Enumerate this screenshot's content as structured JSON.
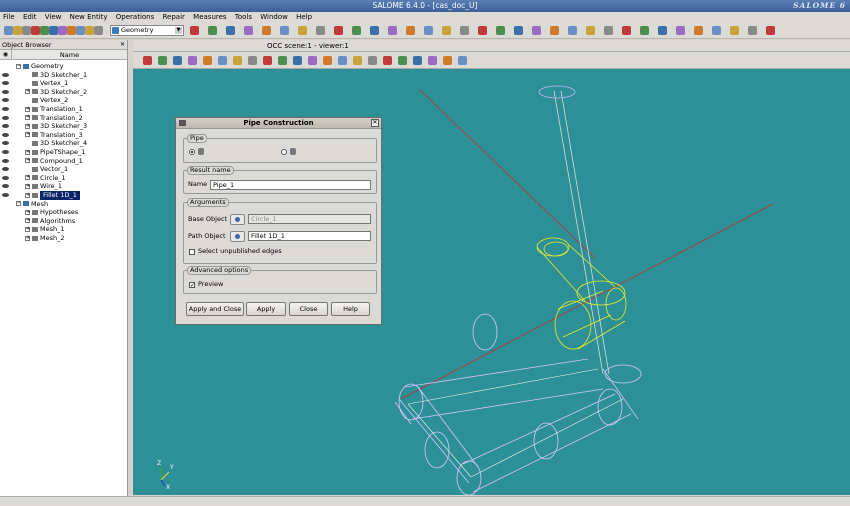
{
  "window": {
    "title": "SALOME 6.4.0 - [cas_doc_U]",
    "brand": "SALOME 6"
  },
  "menu": [
    "File",
    "Edit",
    "View",
    "New Entity",
    "Operations",
    "Repair",
    "Measures",
    "Tools",
    "Window",
    "Help"
  ],
  "toolbar": {
    "module": "Geometry"
  },
  "object_browser": {
    "title": "Object Browser",
    "column_name": "Name",
    "items": [
      {
        "label": "Geometry",
        "depth": 0,
        "expand": "−",
        "eye": false,
        "icon": "geometry-icon"
      },
      {
        "label": "3D Sketcher_1",
        "depth": 1,
        "expand": "",
        "eye": true,
        "icon": "sketch-icon"
      },
      {
        "label": "Vertex_1",
        "depth": 1,
        "expand": "",
        "eye": true,
        "icon": "vertex-icon"
      },
      {
        "label": "3D Sketcher_2",
        "depth": 1,
        "expand": "+",
        "eye": true,
        "icon": "sketch-icon"
      },
      {
        "label": "Vertex_2",
        "depth": 1,
        "expand": "",
        "eye": true,
        "icon": "vertex-icon"
      },
      {
        "label": "Translation_1",
        "depth": 1,
        "expand": "+",
        "eye": true,
        "icon": "translation-icon"
      },
      {
        "label": "Translation_2",
        "depth": 1,
        "expand": "+",
        "eye": true,
        "icon": "translation-icon"
      },
      {
        "label": "3D Sketcher_3",
        "depth": 1,
        "expand": "+",
        "eye": true,
        "icon": "sketch-icon"
      },
      {
        "label": "Translation_3",
        "depth": 1,
        "expand": "+",
        "eye": true,
        "icon": "translation-icon"
      },
      {
        "label": "3D Sketcher_4",
        "depth": 1,
        "expand": "",
        "eye": true,
        "icon": "sketch-icon"
      },
      {
        "label": "PipeTShape_1",
        "depth": 1,
        "expand": "+",
        "eye": true,
        "icon": "pipe-tshape-icon"
      },
      {
        "label": "Compound_1",
        "depth": 1,
        "expand": "+",
        "eye": true,
        "icon": "compound-icon"
      },
      {
        "label": "Vector_1",
        "depth": 1,
        "expand": "",
        "eye": true,
        "icon": "vector-icon"
      },
      {
        "label": "Circle_1",
        "depth": 1,
        "expand": "+",
        "eye": true,
        "icon": "circle-icon"
      },
      {
        "label": "Wire_1",
        "depth": 1,
        "expand": "+",
        "eye": true,
        "icon": "wire-icon"
      },
      {
        "label": "Fillet 1D_1",
        "depth": 1,
        "expand": "+",
        "eye": true,
        "icon": "fillet-icon",
        "selected": true
      },
      {
        "label": "Mesh",
        "depth": 0,
        "expand": "−",
        "eye": false,
        "icon": "mesh-folder-icon"
      },
      {
        "label": "Hypotheses",
        "depth": 1,
        "expand": "+",
        "eye": false,
        "icon": "hypotheses-icon"
      },
      {
        "label": "Algorithms",
        "depth": 1,
        "expand": "+",
        "eye": false,
        "icon": "algorithms-icon"
      },
      {
        "label": "Mesh_1",
        "depth": 1,
        "expand": "+",
        "eye": false,
        "icon": "mesh-icon"
      },
      {
        "label": "Mesh_2",
        "depth": 1,
        "expand": "+",
        "eye": false,
        "icon": "mesh-icon"
      }
    ]
  },
  "viewer": {
    "tab": "OCC scene:1 - viewer:1",
    "background": "#2d9096",
    "axes": {
      "x": "X",
      "y": "Y",
      "z": "Z"
    }
  },
  "dialog": {
    "title": "Pipe Construction",
    "pipe_group": "Pipe",
    "result_group": "Result name",
    "name_label": "Name",
    "name_value": "Pipe_1",
    "arguments_group": "Arguments",
    "base_label": "Base Object",
    "base_value": "Circle_1",
    "path_label": "Path Object",
    "path_value": "Fillet 1D_1",
    "select_edges_label": "Select unpublished edges",
    "advanced_group": "Advanced options",
    "preview_label": "Preview",
    "buttons": {
      "apply_close": "Apply and Close",
      "apply": "Apply",
      "close": "Close",
      "help": "Help"
    }
  }
}
